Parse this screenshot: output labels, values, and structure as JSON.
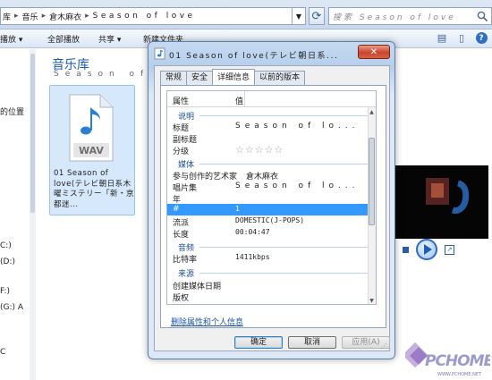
{
  "address_bar": {
    "crumbs": [
      "库",
      "音乐",
      "倉木麻衣",
      "Season of love"
    ],
    "search_placeholder": "搜索 Season of love"
  },
  "toolbar": {
    "items": [
      "播放",
      "全部播放",
      "共享",
      "新建文件夹"
    ]
  },
  "nav_pane": {
    "items": [
      "的位置",
      "C:)",
      "(D:)",
      "F:)",
      "(G:) A",
      "C"
    ]
  },
  "library": {
    "title": "音乐库",
    "subtitle": "Season of lo"
  },
  "file": {
    "type_label": "WAV",
    "name": "01 Season of love(テレビ朝日系木曜ミステリー「新・京都迷..."
  },
  "dialog": {
    "title": "01 Season of love(テレビ朝日系...",
    "close_glyph": "✕",
    "tabs": [
      "常规",
      "安全",
      "详细信息",
      "以前的版本"
    ],
    "active_tab": 2,
    "columns": {
      "property": "属性",
      "value": "值"
    },
    "groups": {
      "description": "说明",
      "media": "媒体",
      "audio": "音频",
      "origin": "来源"
    },
    "rows": {
      "title": {
        "k": "标题",
        "v": "Season of lo..."
      },
      "subtitle": {
        "k": "副标题",
        "v": ""
      },
      "rating": {
        "k": "分级",
        "stars": [
          "☆",
          "☆",
          "☆",
          "☆",
          "☆"
        ]
      },
      "contributing_artist": {
        "k": "参与创作的艺术家",
        "v": "倉木麻衣"
      },
      "album": {
        "k": "唱片集",
        "v": "Season of lo..."
      },
      "year": {
        "k": "年",
        "v": ""
      },
      "track": {
        "k": "#",
        "v": "1"
      },
      "genre": {
        "k": "流派",
        "v": "DOMESTIC(J-POPS)"
      },
      "length": {
        "k": "长度",
        "v": "00:04:47"
      },
      "bitrate": {
        "k": "比特率",
        "v": "1411kbps"
      },
      "media_created": {
        "k": "创建媒体日期",
        "v": ""
      },
      "copyright": {
        "k": "版权",
        "v": ""
      }
    },
    "remove_link": "删除属性和个人信息",
    "buttons": {
      "ok": "确定",
      "cancel": "取消",
      "apply": "应用(A)"
    }
  },
  "watermark": {
    "text": "PCHOME",
    "url": "WWW.PCHOME.NET"
  },
  "colors": {
    "accent_blue": "#1e5cb3",
    "selection": "#3399ff",
    "close_red": "#c8452b"
  }
}
